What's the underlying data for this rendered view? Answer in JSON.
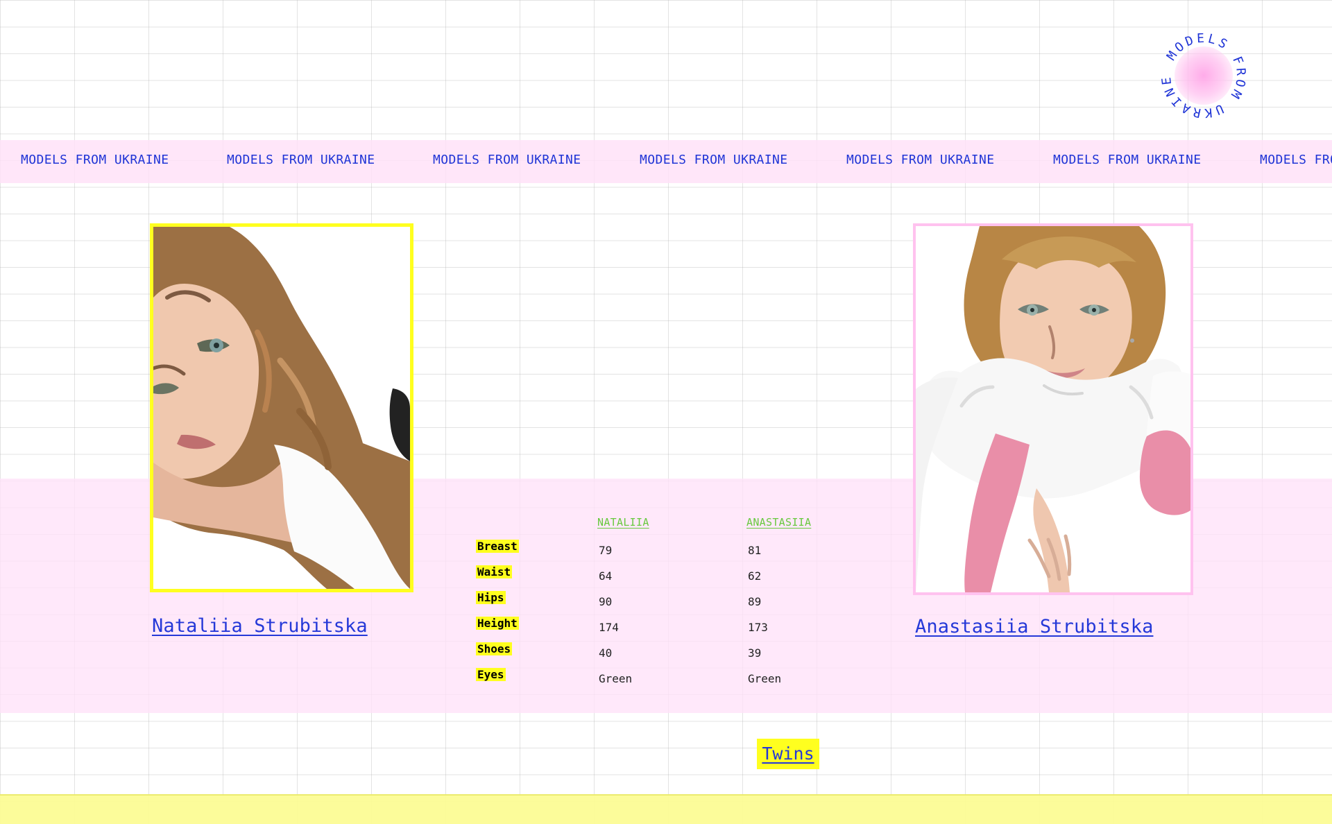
{
  "ticker": {
    "items": [
      "MODELS FROM UKRAINE",
      "MODELS FROM UKRAINE",
      "MODELS FROM UKRAINE",
      "MODELS FROM UKRAINE",
      "MODELS FROM UKRAINE",
      "MODELS FROM UKRAINE",
      "MODELS FROM UKRAINE"
    ]
  },
  "logo": {
    "text": "MODELS FROM UKRAINE",
    "icon": "circular-text-logo"
  },
  "profiles": {
    "left": {
      "name": "Nataliia Strubitska",
      "frame_color": "#ffff1f",
      "icon": "portrait-photo"
    },
    "right": {
      "name": "Anastasiia Strubitska",
      "frame_color": "#ffc2ef",
      "icon": "portrait-photo"
    }
  },
  "stats": {
    "headers": [
      "NATALIIA",
      "ANASTASIIA"
    ],
    "rows": [
      {
        "label": "Breast",
        "nataliia": "79",
        "anastasiia": "81"
      },
      {
        "label": "Waist",
        "nataliia": "64",
        "anastasiia": "62"
      },
      {
        "label": "Hips",
        "nataliia": "90",
        "anastasiia": "89"
      },
      {
        "label": "Height",
        "nataliia": "174",
        "anastasiia": "173"
      },
      {
        "label": "Shoes",
        "nataliia": "40",
        "anastasiia": "39"
      },
      {
        "label": "Eyes",
        "nataliia": "Green",
        "anastasiia": "Green"
      }
    ]
  },
  "cta": {
    "label": "Twins"
  },
  "colors": {
    "grid": "#afafaf",
    "ticker_band": "#ffe1f8",
    "stats_band": "#ffe1f8",
    "footer_band": "#fcfc96",
    "link_blue": "#2438d8",
    "green_header": "#68c93f",
    "yellow_highlight": "#ffff1f"
  }
}
